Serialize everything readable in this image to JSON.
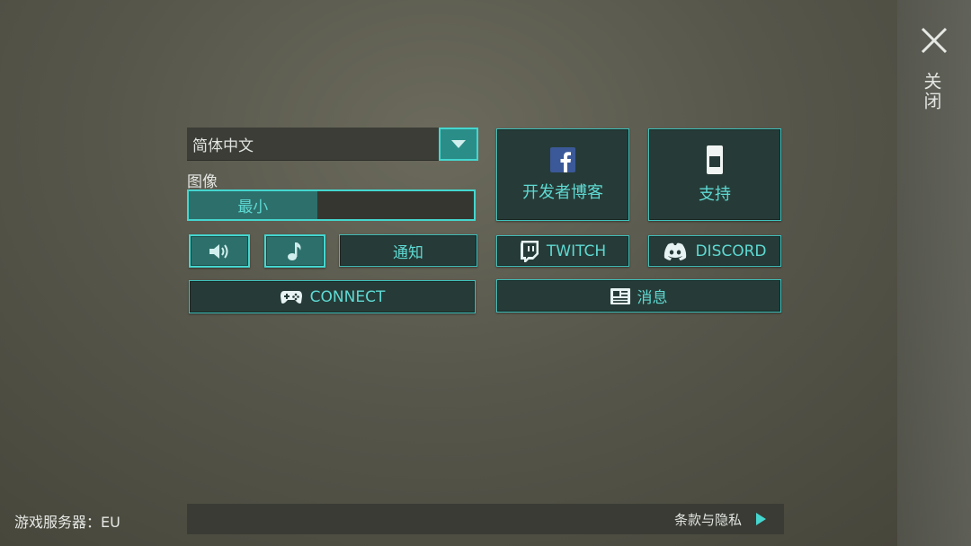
{
  "close": {
    "label": "关闭"
  },
  "language": {
    "selected": "简体中文"
  },
  "graphics": {
    "label": "图像",
    "value_label": "最小",
    "level": 0.45
  },
  "toggles": {
    "notify_label": "通知"
  },
  "connect": {
    "label": "CONNECT"
  },
  "tiles": {
    "dev_blog": "开发者博客",
    "support": "支持",
    "twitch": "TWITCH",
    "discord": "DISCORD",
    "news": "消息"
  },
  "footer": {
    "server": "游戏服务器：EU",
    "terms": "条款与隐私"
  },
  "colors": {
    "accent": "#44d6cf",
    "button_bg": "#263b37",
    "active_bg": "#2d6f6b"
  }
}
